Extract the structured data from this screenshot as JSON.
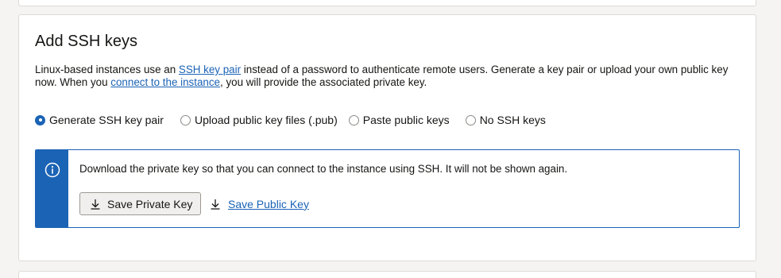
{
  "section": {
    "title": "Add SSH keys",
    "description": {
      "part1": "Linux-based instances use an ",
      "link1": "SSH key pair",
      "part2": " instead of a password to authenticate remote users. Generate a key pair or upload your own public key now. When you ",
      "link2": "connect to the instance",
      "part3": ", you will provide the associated private key."
    },
    "options": [
      {
        "label": "Generate SSH key pair",
        "selected": true
      },
      {
        "label": "Upload public key files (.pub)",
        "selected": false
      },
      {
        "label": "Paste public keys",
        "selected": false
      },
      {
        "label": "No SSH keys",
        "selected": false
      }
    ],
    "info": {
      "icon": "info-icon",
      "message": "Download the private key so that you can connect to the instance using SSH. It will not be shown again.",
      "save_private_label": "Save Private Key",
      "save_public_label": "Save Public Key"
    }
  },
  "colors": {
    "accent": "#1b63b5",
    "border": "#dcdad7",
    "background": "#f5f4f2"
  }
}
